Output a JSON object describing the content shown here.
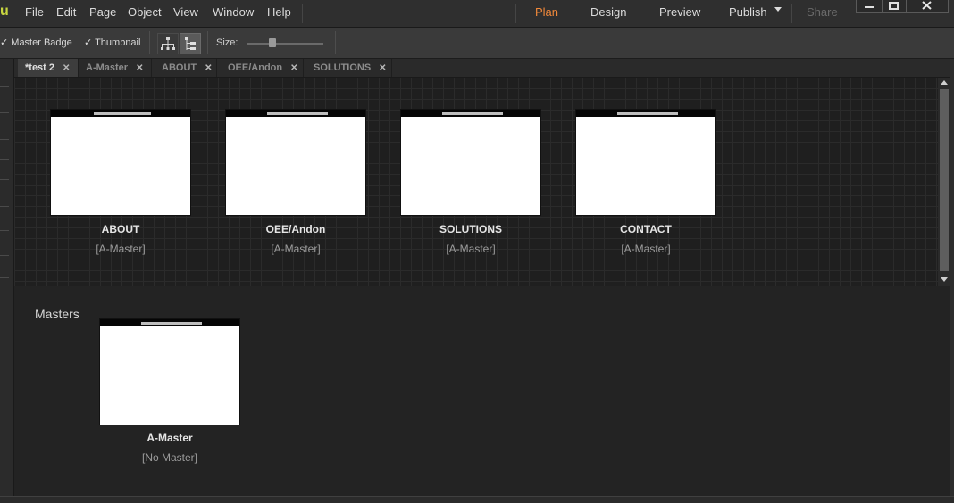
{
  "app": {
    "logo": "u"
  },
  "menu": [
    "File",
    "Edit",
    "Page",
    "Object",
    "View",
    "Window",
    "Help"
  ],
  "modes": {
    "plan": "Plan",
    "design": "Design",
    "preview": "Preview",
    "publish": "Publish",
    "share": "Share",
    "active_color": "#f0883a"
  },
  "toolbar": {
    "master_badge": "Master Badge",
    "thumbnail": "Thumbnail",
    "master_badge_checked": true,
    "thumbnail_checked": true,
    "size_label": "Size:",
    "views": [
      "sitemap-tree-icon",
      "sitemap-list-icon"
    ]
  },
  "tabs": [
    {
      "label": "*test 2",
      "active": true
    },
    {
      "label": "A-Master",
      "active": false
    },
    {
      "label": "ABOUT",
      "active": false
    },
    {
      "label": "OEE/Andon",
      "active": false
    },
    {
      "label": "SOLUTIONS",
      "active": false
    }
  ],
  "pages": [
    {
      "name": "ABOUT",
      "master": "[A-Master]"
    },
    {
      "name": "OEE/Andon",
      "master": "[A-Master]"
    },
    {
      "name": "SOLUTIONS",
      "master": "[A-Master]"
    },
    {
      "name": "CONTACT",
      "master": "[A-Master]"
    }
  ],
  "masters_section": {
    "title": "Masters",
    "items": [
      {
        "name": "A-Master",
        "master": "[No Master]"
      }
    ]
  }
}
